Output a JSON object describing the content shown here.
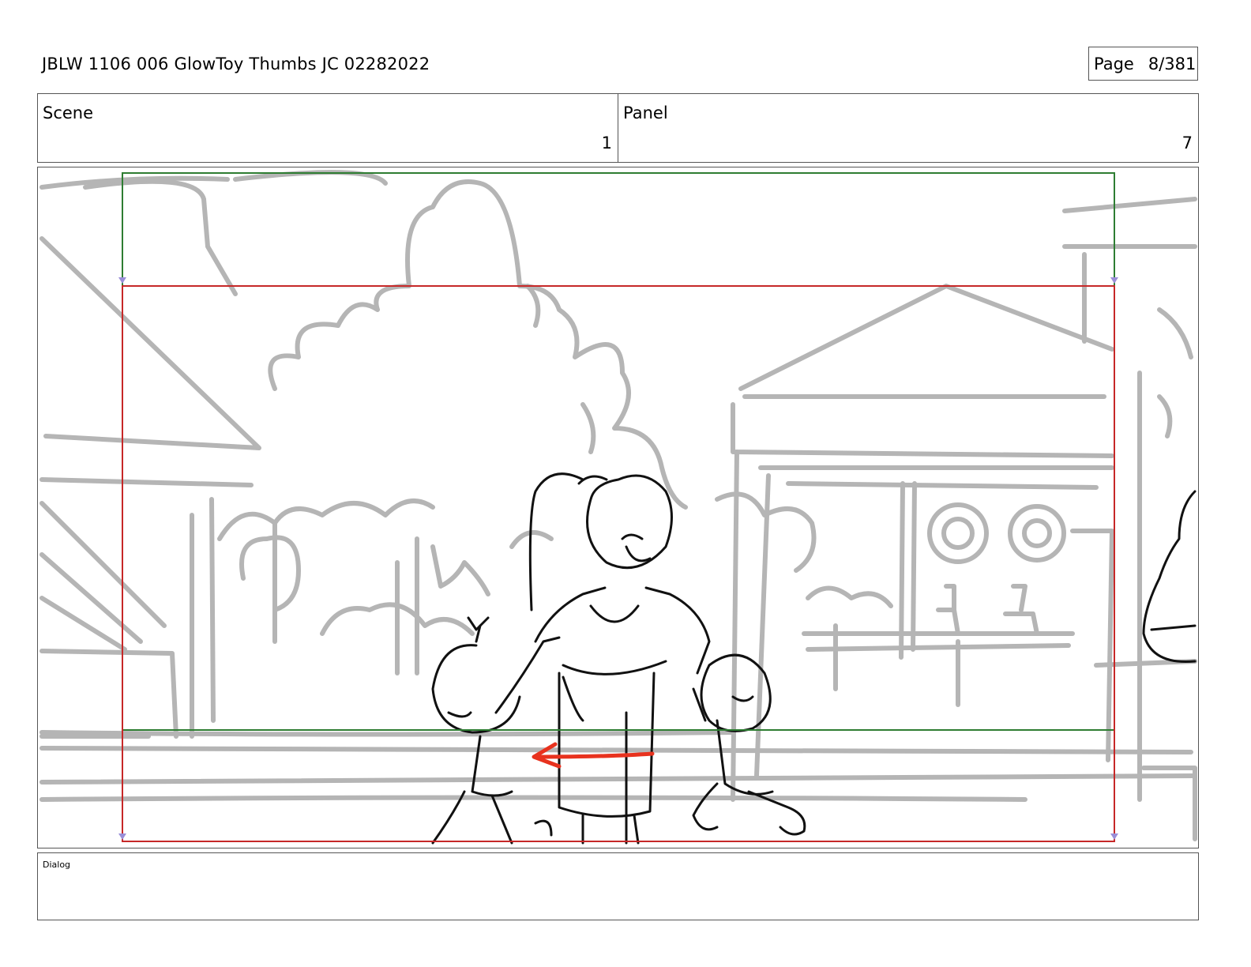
{
  "header": {
    "title": "JBLW 1106 006 GlowToy Thumbs JC 02282022",
    "page_label": "Page",
    "page_number": "8/381"
  },
  "info": {
    "scene_label": "Scene",
    "scene_value": "1",
    "panel_label": "Panel",
    "panel_value": "7"
  },
  "dialog": {
    "label": "Dialog"
  },
  "colors": {
    "safe_frame_green": "#2e7d32",
    "action_frame_red": "#c62828",
    "motion_arrow": "#e8321e",
    "background_sketch": "#b5b5b5"
  }
}
